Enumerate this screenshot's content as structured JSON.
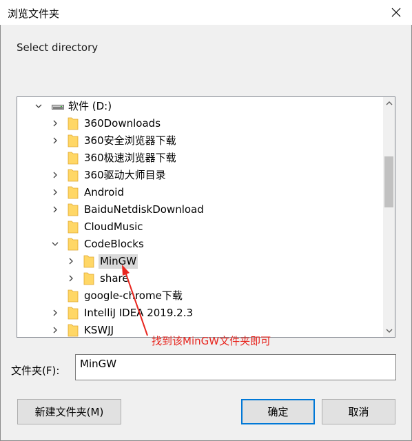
{
  "window": {
    "title": "浏览文件夹",
    "close_icon": "close-icon"
  },
  "prompt": "Select directory",
  "tree": {
    "root": {
      "label": "软件 (D:)",
      "icon": "drive-icon",
      "expanded": true
    },
    "items": [
      {
        "label": "360Downloads",
        "has_children": true,
        "expanded": false
      },
      {
        "label": "360安全浏览器下载",
        "has_children": true,
        "expanded": false
      },
      {
        "label": "360极速浏览器下载",
        "has_children": false
      },
      {
        "label": "360驱动大师目录",
        "has_children": true,
        "expanded": false
      },
      {
        "label": "Android",
        "has_children": true,
        "expanded": false
      },
      {
        "label": "BaiduNetdiskDownload",
        "has_children": true,
        "expanded": false
      },
      {
        "label": "CloudMusic",
        "has_children": false
      },
      {
        "label": "CodeBlocks",
        "has_children": true,
        "expanded": true,
        "children": [
          {
            "label": "MinGW",
            "has_children": true,
            "expanded": false,
            "selected": true
          },
          {
            "label": "share",
            "has_children": true,
            "expanded": false
          }
        ]
      },
      {
        "label": "google-chrome下载",
        "has_children": false
      },
      {
        "label": "IntelliJ IDEA 2019.2.3",
        "has_children": true,
        "expanded": false
      },
      {
        "label": "KSWJJ",
        "has_children": true,
        "expanded": false
      }
    ]
  },
  "annotation": {
    "text": "找到该MinGW文件夹即可",
    "color": "#e8261f"
  },
  "folder_field": {
    "label": "文件夹(F):",
    "value": "MinGW"
  },
  "buttons": {
    "new_folder": "新建文件夹(M)",
    "ok": "确定",
    "cancel": "取消"
  },
  "colors": {
    "accent": "#0078d7",
    "folder": "#ffd766",
    "selection": "#d9d9d9",
    "annotation": "#e8261f"
  }
}
